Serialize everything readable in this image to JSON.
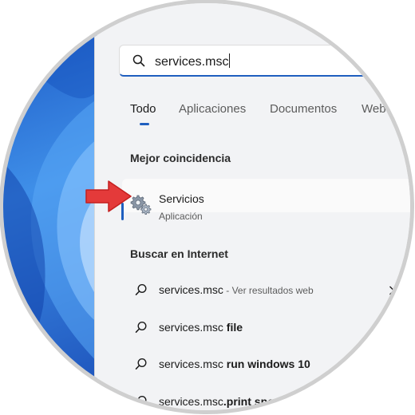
{
  "search": {
    "query": "services.msc"
  },
  "tabs": [
    {
      "label": "Todo"
    },
    {
      "label": "Aplicaciones"
    },
    {
      "label": "Documentos"
    },
    {
      "label": "Web"
    }
  ],
  "best_match": {
    "title": "Mejor coincidencia",
    "name": "Servicios",
    "type": "Aplicación"
  },
  "internet": {
    "title": "Buscar en Internet",
    "results": [
      {
        "prefix": "services.msc",
        "bold": "",
        "suffix": " - Ver resultados web"
      },
      {
        "prefix": "services.msc",
        "bold": " file",
        "suffix": ""
      },
      {
        "prefix": "services.msc",
        "bold": " run windows 10",
        "suffix": ""
      },
      {
        "prefix": "services.msc",
        "bold": ".print spo",
        "suffix": ""
      }
    ]
  },
  "colors": {
    "accent": "#1f5fbf",
    "arrow": "#e43a3a"
  }
}
